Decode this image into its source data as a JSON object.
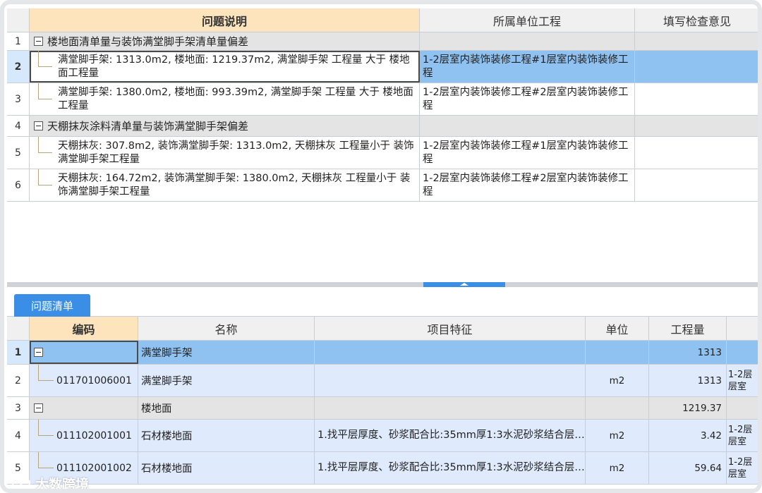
{
  "top_grid": {
    "headers": [
      "问题说明",
      "所属单位工程",
      "填写检查意见"
    ],
    "rows": [
      {
        "num": "1",
        "kind": "group",
        "desc": "楼地面清单量与装饰满堂脚手架清单量偏差",
        "unit": "",
        "note": ""
      },
      {
        "num": "2",
        "kind": "leaf",
        "selected": true,
        "desc": "满堂脚手架: 1313.0m2, 楼地面: 1219.37m2, 满堂脚手架 工程量 大于 楼地面工程量",
        "unit": "1-2层室内装饰装修工程#1层室内装饰装修工程",
        "note": ""
      },
      {
        "num": "3",
        "kind": "leaf",
        "desc": "满堂脚手架: 1380.0m2, 楼地面: 993.39m2, 满堂脚手架 工程量 大于 楼地面工程量",
        "unit": "1-2层室内装饰装修工程#2层室内装饰装修工程",
        "note": ""
      },
      {
        "num": "4",
        "kind": "group",
        "desc": "天棚抹灰涂料清单量与装饰满堂脚手架偏差",
        "unit": "",
        "note": ""
      },
      {
        "num": "5",
        "kind": "leaf",
        "desc": "天棚抹灰: 307.8m2, 装饰满堂脚手架: 1313.0m2, 天棚抹灰 工程量小于 装饰满堂脚手架工程量",
        "unit": "1-2层室内装饰装修工程#1层室内装饰装修工程",
        "note": ""
      },
      {
        "num": "6",
        "kind": "leaf",
        "desc": "天棚抹灰: 164.72m2, 装饰满堂脚手架: 1380.0m2, 天棚抹灰 工程量小于 装饰满堂脚手架工程量",
        "unit": "1-2层室内装饰装修工程#2层室内装饰装修工程",
        "note": ""
      }
    ]
  },
  "tab": {
    "label": "问题清单"
  },
  "bottom_grid": {
    "headers": [
      "编码",
      "名称",
      "项目特征",
      "单位",
      "工程量"
    ],
    "rows": [
      {
        "num": "1",
        "kind": "group",
        "selected": true,
        "code": "",
        "name": "满堂脚手架",
        "feature": "",
        "unit": "",
        "qty": "1313",
        "extra": ""
      },
      {
        "num": "2",
        "kind": "leaf",
        "code": "011701006001",
        "name": "满堂脚手架",
        "feature": "",
        "unit": "m2",
        "qty": "1313",
        "extra": "1-2层层室"
      },
      {
        "num": "3",
        "kind": "group",
        "code": "",
        "name": "楼地面",
        "feature": "",
        "unit": "",
        "qty": "1219.37",
        "extra": ""
      },
      {
        "num": "4",
        "kind": "leaf",
        "code": "011102001001",
        "name": "石材楼地面",
        "feature": "1.找平层厚度、砂浆配合比:35mm厚1:3水泥砂浆结合层…",
        "unit": "m2",
        "qty": "3.42",
        "extra": "1-2层层室"
      },
      {
        "num": "5",
        "kind": "leaf",
        "code": "011102001002",
        "name": "石材楼地面",
        "feature": "1.找平层厚度、砂浆配合比:35mm厚1:3水泥砂浆结合层…",
        "unit": "m2",
        "qty": "59.64",
        "extra": "1-2层层室"
      }
    ]
  },
  "watermark": {
    "text": "大数跨境"
  },
  "colors": {
    "accent": "#3a8ee6",
    "selected_row": "#8fc1f1",
    "header_highlight": "#fde4bd",
    "group_row": "#e4e4e4",
    "leaf_row_bottom": "#dfeafc"
  }
}
